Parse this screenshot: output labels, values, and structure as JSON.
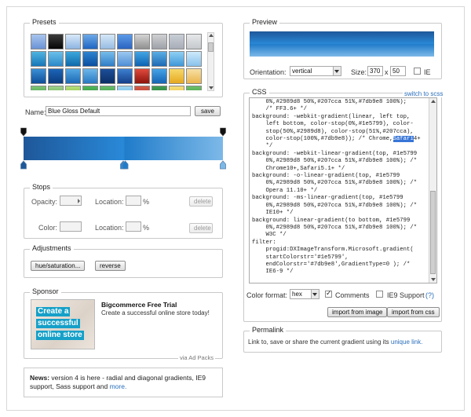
{
  "presets": {
    "legend": "Presets",
    "swatches": [
      {
        "a": "#a9c5ee",
        "b": "#6a93d6"
      },
      {
        "a": "#3b3b3b",
        "b": "#050505"
      },
      {
        "a": "#d8e9f9",
        "b": "#8fb5e2"
      },
      {
        "a": "#6da9e8",
        "b": "#1f66c2"
      },
      {
        "a": "#d5e7f8",
        "b": "#98bce2"
      },
      {
        "a": "#5c9ae8",
        "b": "#2b64c0"
      },
      {
        "a": "#d4d4d4",
        "b": "#909090"
      },
      {
        "a": "#cfd0d2",
        "b": "#9ea2a9"
      },
      {
        "a": "#c9ced6",
        "b": "#a7adb7"
      },
      {
        "a": "#e6e8ea",
        "b": "#c5c8cc"
      },
      {
        "a": "#4fb3e0",
        "b": "#1676b8"
      },
      {
        "a": "#6ac0ea",
        "b": "#2a88c8"
      },
      {
        "a": "#3ca7dc",
        "b": "#0f69a9"
      },
      {
        "a": "#2d83d0",
        "b": "#0a4da0"
      },
      {
        "a": "#77bcea",
        "b": "#2f7dc7"
      },
      {
        "a": "#9cc8f0",
        "b": "#4f8ed6"
      },
      {
        "a": "#42a6e4",
        "b": "#0d62b3"
      },
      {
        "a": "#5aaee4",
        "b": "#1e6ab5"
      },
      {
        "a": "#8fd0f4",
        "b": "#3f97d8"
      },
      {
        "a": "#cde9fa",
        "b": "#89c2ec"
      },
      {
        "a": "#3a8fd6",
        "b": "#0e4d98"
      },
      {
        "a": "#1d65b8",
        "b": "#0b3b7e"
      },
      {
        "a": "#52a6e2",
        "b": "#1d6ab5"
      },
      {
        "a": "#6cb6ea",
        "b": "#2978c2"
      },
      {
        "a": "#1e4f9a",
        "b": "#0c2f66"
      },
      {
        "a": "#3d7fcf",
        "b": "#153f8a"
      },
      {
        "a": "#e04a3c",
        "b": "#8e130c"
      },
      {
        "a": "#45a3e6",
        "b": "#1564b4"
      },
      {
        "a": "#f6d86a",
        "b": "#e6a820"
      },
      {
        "a": "#f7e0a6",
        "b": "#eab44c"
      },
      {
        "a": "#7cc576",
        "b": "#2f8a2d"
      },
      {
        "a": "#9ed38a",
        "b": "#4d9a3a"
      },
      {
        "a": "#b7e07b",
        "b": "#6fae2a"
      },
      {
        "a": "#4fb85a",
        "b": "#237a2a"
      },
      {
        "a": "#66c06a",
        "b": "#2c7e30"
      },
      {
        "a": "#9fd5f2",
        "b": "#58a9dc"
      },
      {
        "a": "#d65b4a",
        "b": "#9a2518"
      },
      {
        "a": "#3f9c52",
        "b": "#1b6b2b"
      },
      {
        "a": "#f5dd7a",
        "b": "#e9b930"
      },
      {
        "a": "#6dc06a",
        "b": "#2d8a2f"
      }
    ]
  },
  "name": {
    "label": "Name:",
    "value": "Blue Gloss Default",
    "save_label": "save"
  },
  "gradient": {
    "stops": [
      {
        "color": "#1e5799",
        "location": 0
      },
      {
        "color": "#2989d8",
        "location": 50
      },
      {
        "color": "#207cca",
        "location": 51
      },
      {
        "color": "#7db9e8",
        "location": 100
      }
    ],
    "opacity_stops": [
      {
        "opacity": 100,
        "location": 0
      },
      {
        "opacity": 100,
        "location": 100
      }
    ]
  },
  "stops": {
    "legend": "Stops",
    "opacity_label": "Opacity:",
    "color_label": "Color:",
    "location_label": "Location:",
    "percent": "%",
    "delete_label": "delete"
  },
  "adjustments": {
    "legend": "Adjustments",
    "hue_label": "hue/saturation...",
    "reverse_label": "reverse"
  },
  "sponsor": {
    "legend": "Sponsor",
    "ad_lines": [
      "Create a",
      "successful",
      "online store"
    ],
    "title": "Bigcommerce Free Trial",
    "text": "Create a successful online store today!",
    "via": "via Ad Packs"
  },
  "news": {
    "label": "News:",
    "text": " version 4 is here - radial and diagonal gradients, IE9 support, Sass support and ",
    "more": "more."
  },
  "preview": {
    "legend": "Preview",
    "orientation_label": "Orientation:",
    "orientation_value": "vertical",
    "size_label": "Size:",
    "width": "370",
    "x": "x",
    "height": "50",
    "ie_label": "IE"
  },
  "css": {
    "legend": "CSS",
    "switch_link": "switch to scss",
    "lines": [
      "    0%,#2989d8 50%,#207cca 51%,#7db9e8 100%);",
      "    /* FF3.6+ */",
      "background: -webkit-gradient(linear, left top,",
      "    left bottom, color-stop(0%,#1e5799), color-",
      "    stop(50%,#2989d8), color-stop(51%,#207cca),",
      "    color-stop(100%,#7db9e8)); /* Chrome,Safari4+",
      "    */",
      "background: -webkit-linear-gradient(top, #1e5799",
      "    0%,#2989d8 50%,#207cca 51%,#7db9e8 100%); /*",
      "    Chrome10+,Safari5.1+ */",
      "background: -o-linear-gradient(top, #1e5799",
      "    0%,#2989d8 50%,#207cca 51%,#7db9e8 100%); /*",
      "    Opera 11.10+ */",
      "background: -ms-linear-gradient(top, #1e5799",
      "    0%,#2989d8 50%,#207cca 51%,#7db9e8 100%); /*",
      "    IE10+ */",
      "background: linear-gradient(to bottom, #1e5799",
      "    0%,#2989d8 50%,#207cca 51%,#7db9e8 100%); /*",
      "    W3C */",
      "filter:",
      "    progid:DXImageTransform.Microsoft.gradient(",
      "    startColorstr='#1e5799',",
      "    endColorstr='#7db9e8',GradientType=0 ); /*",
      "    IE6-9 */"
    ],
    "highlight_word": "Safari",
    "color_format_label": "Color format:",
    "color_format_value": "hex",
    "comments_label": "Comments",
    "ie9_label": "IE9 Support",
    "help": "(?)",
    "import_image_label": "import from image",
    "import_css_label": "import from css"
  },
  "permalink": {
    "legend": "Permalink",
    "text": "Link to, save or share the current gradient using its ",
    "link": "unique link."
  },
  "colors": {
    "accent_link": "#2a6ebb",
    "stop_marker": "#5b7fa6",
    "preview_top": "#1e5799",
    "preview_bottom": "#7db9e8"
  }
}
